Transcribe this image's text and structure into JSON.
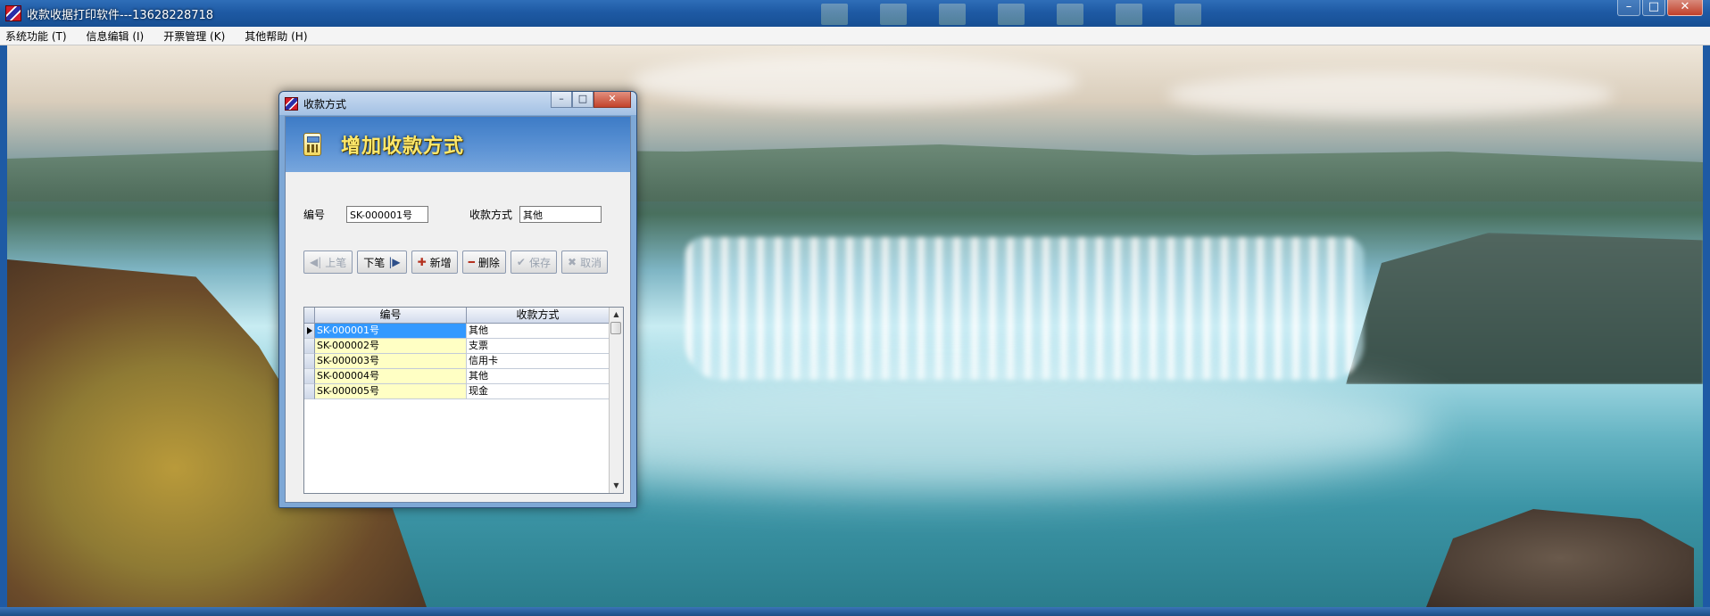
{
  "main_window": {
    "title": "收款收据打印软件---13628228718",
    "controls": {
      "minimize": "–",
      "maximize": "□",
      "close": "✕"
    }
  },
  "menu": {
    "items": [
      {
        "label": "系统功能 (T)"
      },
      {
        "label": "信息编辑 (I)"
      },
      {
        "label": "开票管理 (K)"
      },
      {
        "label": "其他帮助 (H)"
      }
    ]
  },
  "dialog": {
    "title": "收款方式",
    "controls": {
      "minimize": "–",
      "maximize": "□",
      "close": "✕"
    },
    "banner_title": "增加收款方式",
    "form": {
      "code_label": "编号",
      "code_value": "SK-000001号",
      "method_label": "收款方式",
      "method_value": "其他"
    },
    "toolbar": {
      "prev": {
        "label": "上笔",
        "icon": "◀|",
        "enabled": false
      },
      "next": {
        "label": "下笔",
        "icon": "|▶",
        "enabled": true
      },
      "add": {
        "label": "新增",
        "icon": "✚",
        "enabled": true
      },
      "delete": {
        "label": "删除",
        "icon": "━",
        "enabled": true
      },
      "save": {
        "label": "保存",
        "icon": "✔",
        "enabled": false
      },
      "cancel": {
        "label": "取消",
        "icon": "✖",
        "enabled": false
      }
    },
    "grid": {
      "columns": [
        "编号",
        "收款方式"
      ],
      "rows": [
        {
          "code": "SK-000001号",
          "method": "其他"
        },
        {
          "code": "SK-000002号",
          "method": "支票"
        },
        {
          "code": "SK-000003号",
          "method": "信用卡"
        },
        {
          "code": "SK-000004号",
          "method": "其他"
        },
        {
          "code": "SK-000005号",
          "method": "现金"
        }
      ],
      "selected_index": 0
    }
  },
  "colors": {
    "titlebar": "#1e5aa4",
    "banner": "#4a86cc",
    "banner_text": "#ffe86a",
    "selected_cell": "#3399ff",
    "code_cell": "#ffffc4"
  }
}
